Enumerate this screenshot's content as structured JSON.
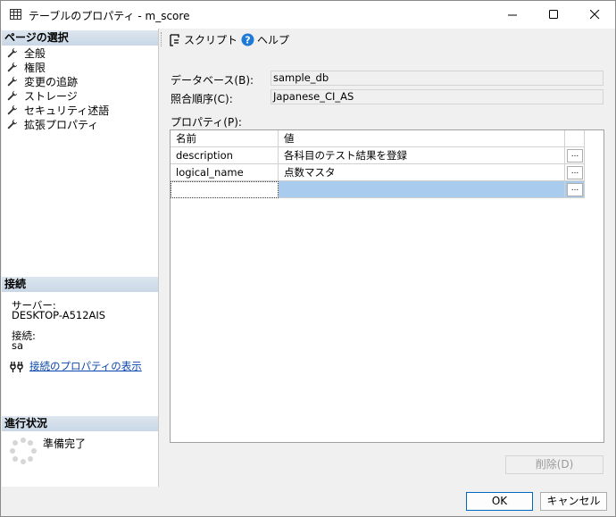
{
  "window": {
    "title": "テーブルのプロパティ - m_score"
  },
  "left": {
    "pages_header": "ページの選択",
    "pages": [
      "全般",
      "権限",
      "変更の追跡",
      "ストレージ",
      "セキュリティ述語",
      "拡張プロパティ"
    ],
    "connection_header": "接続",
    "server_label": "サーバー:",
    "server_value": "DESKTOP-A512AIS",
    "conn_label": "接続:",
    "conn_value": "sa",
    "conn_props_link": "接続のプロパティの表示",
    "progress_header": "進行状況",
    "progress_status": "準備完了"
  },
  "toolbar": {
    "script": "スクリプト",
    "help": "ヘルプ"
  },
  "fields": {
    "database_label": "データベース(B):",
    "database_value": "sample_db",
    "collation_label": "照合順序(C):",
    "collation_value": "Japanese_CI_AS",
    "properties_label": "プロパティ(P):"
  },
  "grid": {
    "columns": [
      "名前",
      "値"
    ],
    "rows": [
      {
        "name": "description",
        "value": "各科目のテスト結果を登録"
      },
      {
        "name": "logical_name",
        "value": "点数マスタ"
      },
      {
        "name": "",
        "value": ""
      }
    ],
    "ellipsis": "..."
  },
  "buttons": {
    "delete": "削除(D)",
    "ok": "OK",
    "cancel": "キャンセル"
  }
}
